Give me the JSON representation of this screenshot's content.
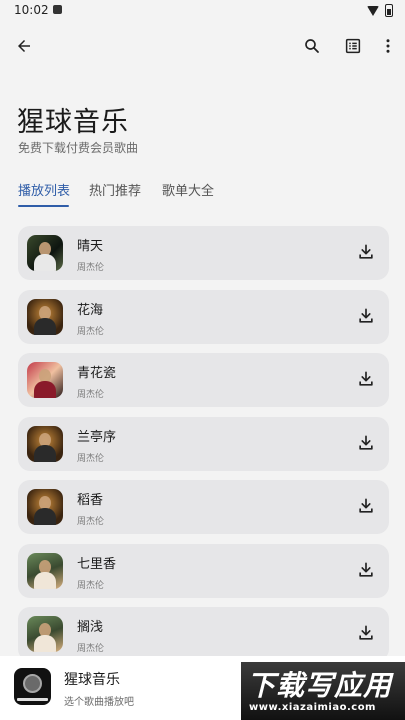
{
  "status_bar": {
    "time": "10:02"
  },
  "header": {
    "title": "猩球音乐",
    "subtitle": "免费下载付费会员歌曲"
  },
  "tabs": [
    {
      "label": "播放列表",
      "active": true
    },
    {
      "label": "热门推荐",
      "active": false
    },
    {
      "label": "歌单大全",
      "active": false
    }
  ],
  "songs": [
    {
      "title": "晴天",
      "artist": "周杰伦"
    },
    {
      "title": "花海",
      "artist": "周杰伦"
    },
    {
      "title": "青花瓷",
      "artist": "周杰伦"
    },
    {
      "title": "兰亭序",
      "artist": "周杰伦"
    },
    {
      "title": "稻香",
      "artist": "周杰伦"
    },
    {
      "title": "七里香",
      "artist": "周杰伦"
    },
    {
      "title": "搁浅",
      "artist": "周杰伦"
    }
  ],
  "player": {
    "title": "猩球音乐",
    "subtitle": "选个歌曲播放吧"
  },
  "watermark": {
    "text": "下载写应用",
    "url": "www.xiazaimiao.com"
  },
  "colors": {
    "accent": "#2f5da8",
    "card": "#e6e6e8",
    "background": "#f3f3f3"
  },
  "icons": [
    "back-arrow-icon",
    "search-icon",
    "list-view-icon",
    "more-vert-icon",
    "download-icon"
  ]
}
